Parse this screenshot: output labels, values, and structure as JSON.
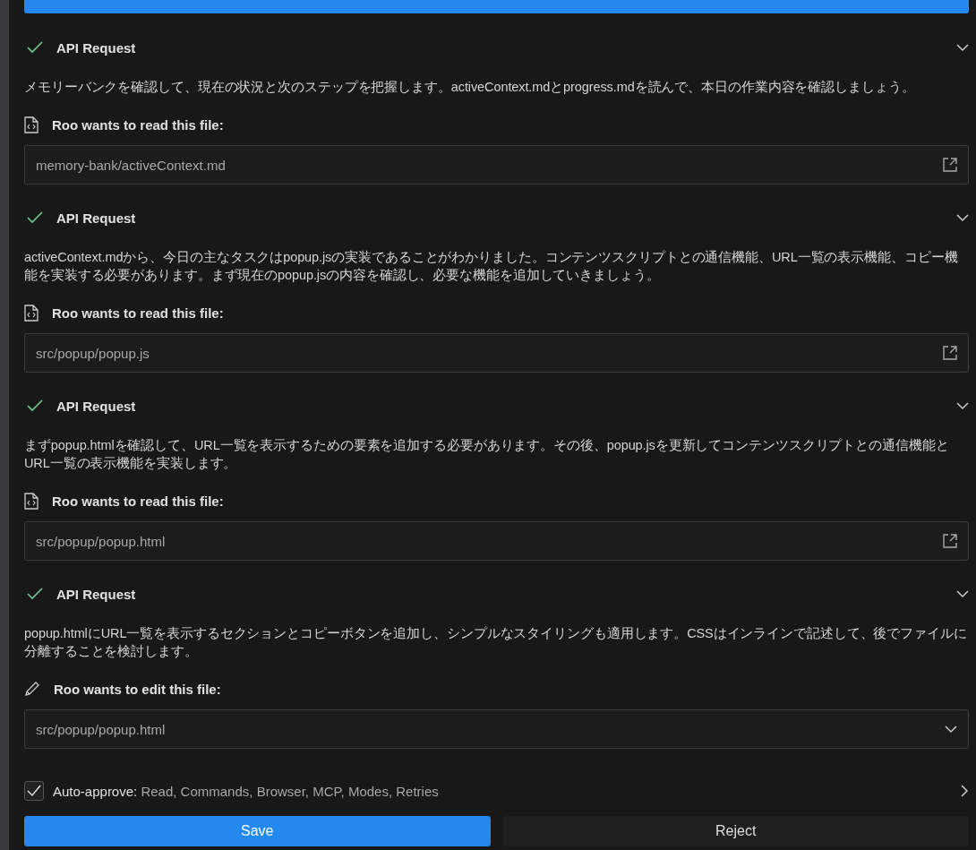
{
  "entries": [
    {
      "title": "API Request",
      "done": true,
      "message": "メモリーバンクを確認して、現在の状況と次のステップを把握します。activeContext.mdとprogress.mdを読んで、本日の作業内容を確認しましょう。",
      "tool": {
        "kind": "read",
        "label": "Roo wants to read this file:",
        "path": "memory-bank/activeContext.md"
      }
    },
    {
      "title": "API Request",
      "done": true,
      "message": "activeContext.mdから、今日の主なタスクはpopup.jsの実装であることがわかりました。コンテンツスクリプトとの通信機能、URL一覧の表示機能、コピー機能を実装する必要があります。まず現在のpopup.jsの内容を確認し、必要な機能を追加していきましょう。",
      "tool": {
        "kind": "read",
        "label": "Roo wants to read this file:",
        "path": "src/popup/popup.js"
      }
    },
    {
      "title": "API Request",
      "done": true,
      "message": "まずpopup.htmlを確認して、URL一覧を表示するための要素を追加する必要があります。その後、popup.jsを更新してコンテンツスクリプトとの通信機能とURL一覧の表示機能を実装します。",
      "tool": {
        "kind": "read",
        "label": "Roo wants to read this file:",
        "path": "src/popup/popup.html"
      }
    },
    {
      "title": "API Request",
      "done": true,
      "message": "popup.htmlにURL一覧を表示するセクションとコピーボタンを追加し、シンプルなスタイリングも適用します。CSSはインラインで記述して、後でファイルに分離することを検討します。",
      "tool": {
        "kind": "edit",
        "label": "Roo wants to edit this file:",
        "path": "src/popup/popup.html"
      }
    }
  ],
  "auto_approve": {
    "checked": true,
    "label": "Auto-approve:",
    "items": "Read, Commands, Browser, MCP, Modes, Retries"
  },
  "buttons": [
    {
      "kind": "primary",
      "label": "Save"
    },
    {
      "kind": "secondary",
      "label": "Reject"
    }
  ]
}
